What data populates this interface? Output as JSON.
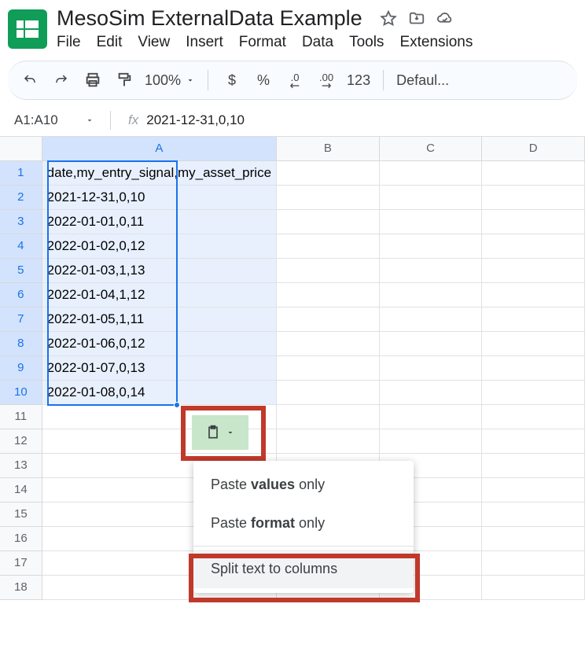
{
  "doc": {
    "title": "MesoSim ExternalData Example"
  },
  "menubar": [
    "File",
    "Edit",
    "View",
    "Insert",
    "Format",
    "Data",
    "Tools",
    "Extensions"
  ],
  "toolbar": {
    "zoom": "100%",
    "currency_dec": ".0",
    "currency_inc": ".00",
    "number_format": "123",
    "font": "Defaul..."
  },
  "namebox": {
    "ref": "A1:A10",
    "formula": "2021-12-31,0,10"
  },
  "columns": [
    "A",
    "B",
    "C",
    "D"
  ],
  "rows_data": [
    "date,my_entry_signal,my_asset_price",
    "2021-12-31,0,10",
    "2022-01-01,0,11",
    "2022-01-02,0,12",
    "2022-01-03,1,13",
    "2022-01-04,1,12",
    "2022-01-05,1,11",
    "2022-01-06,0,12",
    "2022-01-07,0,13",
    "2022-01-08,0,14"
  ],
  "row_numbers": [
    "1",
    "2",
    "3",
    "4",
    "5",
    "6",
    "7",
    "8",
    "9",
    "10",
    "11",
    "12",
    "13",
    "14",
    "15",
    "16",
    "17",
    "18"
  ],
  "paste_menu": {
    "values_pre": "Paste ",
    "values_bold": "values",
    "values_post": " only",
    "format_pre": "Paste ",
    "format_bold": "format",
    "format_post": " only",
    "split": "Split text to columns"
  }
}
